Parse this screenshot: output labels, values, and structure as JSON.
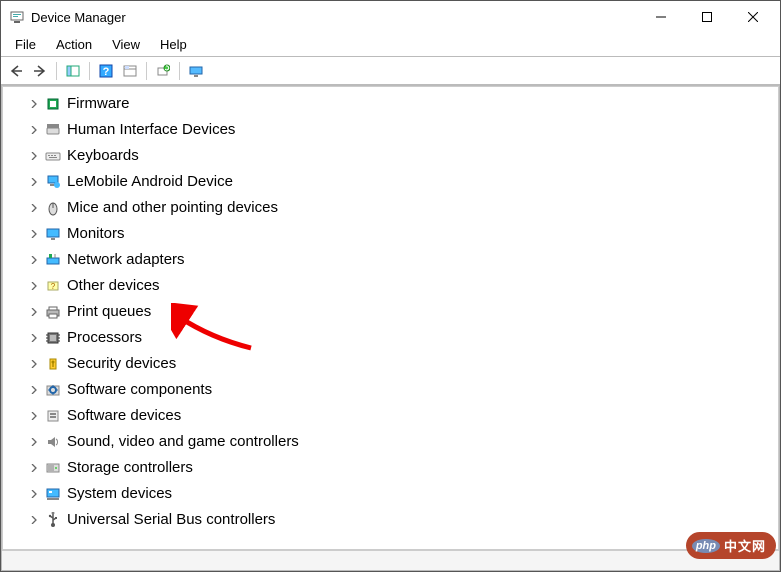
{
  "window": {
    "title": "Device Manager"
  },
  "menu": {
    "file": "File",
    "action": "Action",
    "view": "View",
    "help": "Help"
  },
  "tree": {
    "items": [
      {
        "label": "Firmware",
        "icon": "firmware"
      },
      {
        "label": "Human Interface Devices",
        "icon": "hid"
      },
      {
        "label": "Keyboards",
        "icon": "keyboard"
      },
      {
        "label": "LeMobile Android Device",
        "icon": "android"
      },
      {
        "label": "Mice and other pointing devices",
        "icon": "mouse"
      },
      {
        "label": "Monitors",
        "icon": "monitor"
      },
      {
        "label": "Network adapters",
        "icon": "network"
      },
      {
        "label": "Other devices",
        "icon": "other"
      },
      {
        "label": "Print queues",
        "icon": "printer"
      },
      {
        "label": "Processors",
        "icon": "processor"
      },
      {
        "label": "Security devices",
        "icon": "security"
      },
      {
        "label": "Software components",
        "icon": "software-comp"
      },
      {
        "label": "Software devices",
        "icon": "software-dev"
      },
      {
        "label": "Sound, video and game controllers",
        "icon": "sound"
      },
      {
        "label": "Storage controllers",
        "icon": "storage"
      },
      {
        "label": "System devices",
        "icon": "system"
      },
      {
        "label": "Universal Serial Bus controllers",
        "icon": "usb"
      }
    ]
  },
  "watermark": {
    "logo": "php",
    "text": "中文网"
  }
}
